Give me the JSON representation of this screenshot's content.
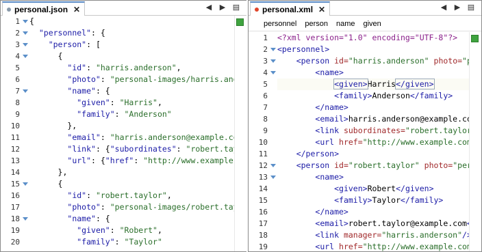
{
  "left": {
    "tab": {
      "label": "personal.json",
      "dot_color": "#8a9aaa"
    },
    "lines": [
      {
        "n": "1",
        "fold": true,
        "parts": [
          [
            "p",
            "{"
          ]
        ]
      },
      {
        "n": "2",
        "fold": true,
        "parts": [
          [
            "p",
            "  "
          ],
          [
            "k",
            "\"personnel\""
          ],
          [
            "p",
            ": {"
          ]
        ]
      },
      {
        "n": "3",
        "fold": true,
        "parts": [
          [
            "p",
            "    "
          ],
          [
            "k",
            "\"person\""
          ],
          [
            "p",
            ": ["
          ]
        ]
      },
      {
        "n": "4",
        "fold": true,
        "parts": [
          [
            "p",
            "      {"
          ]
        ]
      },
      {
        "n": "5",
        "fold": false,
        "parts": [
          [
            "p",
            "        "
          ],
          [
            "k",
            "\"id\""
          ],
          [
            "p",
            ": "
          ],
          [
            "s",
            "\"harris.anderson\""
          ],
          [
            "p",
            ","
          ]
        ]
      },
      {
        "n": "6",
        "fold": false,
        "parts": [
          [
            "p",
            "        "
          ],
          [
            "k",
            "\"photo\""
          ],
          [
            "p",
            ": "
          ],
          [
            "s",
            "\"personal-images/harris.anderson.jpg\""
          ],
          [
            "p",
            ","
          ]
        ]
      },
      {
        "n": "7",
        "fold": true,
        "parts": [
          [
            "p",
            "        "
          ],
          [
            "k",
            "\"name\""
          ],
          [
            "p",
            ": {"
          ]
        ]
      },
      {
        "n": "8",
        "fold": false,
        "parts": [
          [
            "p",
            "          "
          ],
          [
            "k",
            "\"given\""
          ],
          [
            "p",
            ": "
          ],
          [
            "s",
            "\"Harris\""
          ],
          [
            "p",
            ","
          ]
        ]
      },
      {
        "n": "9",
        "fold": false,
        "parts": [
          [
            "p",
            "          "
          ],
          [
            "k",
            "\"family\""
          ],
          [
            "p",
            ": "
          ],
          [
            "s",
            "\"Anderson\""
          ]
        ]
      },
      {
        "n": "10",
        "fold": false,
        "parts": [
          [
            "p",
            "        },"
          ]
        ]
      },
      {
        "n": "11",
        "fold": false,
        "parts": [
          [
            "p",
            "        "
          ],
          [
            "k",
            "\"email\""
          ],
          [
            "p",
            ": "
          ],
          [
            "s",
            "\"harris.anderson@example.com\""
          ],
          [
            "p",
            ","
          ]
        ]
      },
      {
        "n": "12",
        "fold": false,
        "parts": [
          [
            "p",
            "        "
          ],
          [
            "k",
            "\"link\""
          ],
          [
            "p",
            ": {"
          ],
          [
            "k",
            "\"subordinates\""
          ],
          [
            "p",
            ": "
          ],
          [
            "s",
            "\"robert.taylor\""
          ],
          [
            "p",
            "},"
          ]
        ]
      },
      {
        "n": "13",
        "fold": false,
        "parts": [
          [
            "p",
            "        "
          ],
          [
            "k",
            "\"url\""
          ],
          [
            "p",
            ": {"
          ],
          [
            "k",
            "\"href\""
          ],
          [
            "p",
            ": "
          ],
          [
            "s",
            "\"http://www.example.com\""
          ],
          [
            "p",
            "}"
          ]
        ]
      },
      {
        "n": "14",
        "fold": false,
        "parts": [
          [
            "p",
            "      },"
          ]
        ]
      },
      {
        "n": "15",
        "fold": true,
        "parts": [
          [
            "p",
            "      {"
          ]
        ]
      },
      {
        "n": "16",
        "fold": false,
        "parts": [
          [
            "p",
            "        "
          ],
          [
            "k",
            "\"id\""
          ],
          [
            "p",
            ": "
          ],
          [
            "s",
            "\"robert.taylor\""
          ],
          [
            "p",
            ","
          ]
        ]
      },
      {
        "n": "17",
        "fold": false,
        "parts": [
          [
            "p",
            "        "
          ],
          [
            "k",
            "\"photo\""
          ],
          [
            "p",
            ": "
          ],
          [
            "s",
            "\"personal-images/robert.taylor.jpg\""
          ],
          [
            "p",
            ","
          ]
        ]
      },
      {
        "n": "18",
        "fold": true,
        "parts": [
          [
            "p",
            "        "
          ],
          [
            "k",
            "\"name\""
          ],
          [
            "p",
            ": {"
          ]
        ]
      },
      {
        "n": "19",
        "fold": false,
        "parts": [
          [
            "p",
            "          "
          ],
          [
            "k",
            "\"given\""
          ],
          [
            "p",
            ": "
          ],
          [
            "s",
            "\"Robert\""
          ],
          [
            "p",
            ","
          ]
        ]
      },
      {
        "n": "20",
        "fold": false,
        "parts": [
          [
            "p",
            "          "
          ],
          [
            "k",
            "\"family\""
          ],
          [
            "p",
            ": "
          ],
          [
            "s",
            "\"Taylor\""
          ]
        ]
      }
    ]
  },
  "right": {
    "tab": {
      "label": "personal.xml",
      "dot_color": "#e0452a"
    },
    "breadcrumb": [
      "personnel",
      "person",
      "name",
      "given"
    ],
    "lines": [
      {
        "n": "1",
        "fold": false,
        "parts": [
          [
            "pi",
            "<?xml version=\"1.0\" encoding=\"UTF-8\"?>"
          ]
        ]
      },
      {
        "n": "2",
        "fold": true,
        "parts": [
          [
            "t",
            "<personnel>"
          ]
        ]
      },
      {
        "n": "3",
        "fold": true,
        "parts": [
          [
            "x",
            "    "
          ],
          [
            "t",
            "<person "
          ],
          [
            "a",
            "id="
          ],
          [
            "v",
            "\"harris.anderson\""
          ],
          [
            "t",
            " "
          ],
          [
            "a",
            "photo="
          ],
          [
            "v",
            "\"personal-images/harris.anderson.jpg\""
          ],
          [
            "t",
            ">"
          ]
        ]
      },
      {
        "n": "4",
        "fold": true,
        "parts": [
          [
            "x",
            "        "
          ],
          [
            "t",
            "<name>"
          ]
        ]
      },
      {
        "n": "5",
        "fold": false,
        "cur": true,
        "parts": [
          [
            "x",
            "            "
          ],
          [
            "th",
            "<given>"
          ],
          [
            "x",
            "Harris"
          ],
          [
            "th",
            "</given>"
          ]
        ]
      },
      {
        "n": "6",
        "fold": false,
        "parts": [
          [
            "x",
            "            "
          ],
          [
            "t",
            "<family>"
          ],
          [
            "x",
            "Anderson"
          ],
          [
            "t",
            "</family>"
          ]
        ]
      },
      {
        "n": "7",
        "fold": false,
        "parts": [
          [
            "x",
            "        "
          ],
          [
            "t",
            "</name>"
          ]
        ]
      },
      {
        "n": "8",
        "fold": false,
        "parts": [
          [
            "x",
            "        "
          ],
          [
            "t",
            "<email>"
          ],
          [
            "x",
            "harris.anderson@example.com"
          ],
          [
            "t",
            "</email>"
          ]
        ]
      },
      {
        "n": "9",
        "fold": false,
        "parts": [
          [
            "x",
            "        "
          ],
          [
            "t",
            "<link "
          ],
          [
            "a",
            "subordinates="
          ],
          [
            "v",
            "\"robert.taylor\""
          ],
          [
            "t",
            "/>"
          ]
        ]
      },
      {
        "n": "10",
        "fold": false,
        "parts": [
          [
            "x",
            "        "
          ],
          [
            "t",
            "<url "
          ],
          [
            "a",
            "href="
          ],
          [
            "v",
            "\"http://www.example.com\""
          ],
          [
            "t",
            "/>"
          ]
        ]
      },
      {
        "n": "11",
        "fold": false,
        "parts": [
          [
            "x",
            "    "
          ],
          [
            "t",
            "</person>"
          ]
        ]
      },
      {
        "n": "12",
        "fold": true,
        "parts": [
          [
            "x",
            "    "
          ],
          [
            "t",
            "<person "
          ],
          [
            "a",
            "id="
          ],
          [
            "v",
            "\"robert.taylor\""
          ],
          [
            "t",
            " "
          ],
          [
            "a",
            "photo="
          ],
          [
            "v",
            "\"personal-images/robert.taylor.jpg\""
          ],
          [
            "t",
            ">"
          ]
        ]
      },
      {
        "n": "13",
        "fold": true,
        "parts": [
          [
            "x",
            "        "
          ],
          [
            "t",
            "<name>"
          ]
        ]
      },
      {
        "n": "14",
        "fold": false,
        "parts": [
          [
            "x",
            "            "
          ],
          [
            "t",
            "<given>"
          ],
          [
            "x",
            "Robert"
          ],
          [
            "t",
            "</given>"
          ]
        ]
      },
      {
        "n": "15",
        "fold": false,
        "parts": [
          [
            "x",
            "            "
          ],
          [
            "t",
            "<family>"
          ],
          [
            "x",
            "Taylor"
          ],
          [
            "t",
            "</family>"
          ]
        ]
      },
      {
        "n": "16",
        "fold": false,
        "parts": [
          [
            "x",
            "        "
          ],
          [
            "t",
            "</name>"
          ]
        ]
      },
      {
        "n": "17",
        "fold": false,
        "parts": [
          [
            "x",
            "        "
          ],
          [
            "t",
            "<email>"
          ],
          [
            "x",
            "robert.taylor@example.com"
          ],
          [
            "t",
            "</email>"
          ]
        ]
      },
      {
        "n": "18",
        "fold": false,
        "parts": [
          [
            "x",
            "        "
          ],
          [
            "t",
            "<link "
          ],
          [
            "a",
            "manager="
          ],
          [
            "v",
            "\"harris.anderson\""
          ],
          [
            "t",
            "/>"
          ]
        ]
      },
      {
        "n": "19",
        "fold": false,
        "parts": [
          [
            "x",
            "        "
          ],
          [
            "t",
            "<url "
          ],
          [
            "a",
            "href="
          ],
          [
            "v",
            "\"http://www.example.com\""
          ],
          [
            "t",
            "/>"
          ]
        ]
      }
    ]
  },
  "toolbar": {
    "prev": "◀",
    "next": "▶",
    "menu": "▤",
    "close": "✕"
  },
  "colors": {
    "ok_marker": "#3fa33f",
    "json_dot": "#8a9aaa",
    "xml_dot": "#e0452a"
  }
}
